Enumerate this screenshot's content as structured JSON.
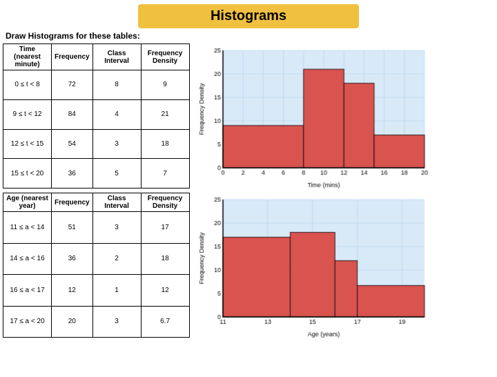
{
  "title": "Histograms",
  "subtitle": "Draw Histograms for these tables:",
  "table1": {
    "headers": [
      "Time (nearest minute)",
      "Frequency",
      "Class Interval",
      "Frequency Density"
    ],
    "rows": [
      [
        "0 ≤ t < 8",
        "72",
        "8",
        "9"
      ],
      [
        "9 ≤ t < 12",
        "84",
        "4",
        "21"
      ],
      [
        "12 ≤ t < 15",
        "54",
        "3",
        "18"
      ],
      [
        "15 ≤ t < 20",
        "36",
        "5",
        "7"
      ]
    ]
  },
  "table2": {
    "headers": [
      "Age (nearest year)",
      "Frequency",
      "Class Interval",
      "Frequency Density"
    ],
    "rows": [
      [
        "11 ≤ a < 14",
        "51",
        "3",
        "17"
      ],
      [
        "14 ≤ a < 16",
        "36",
        "2",
        "18"
      ],
      [
        "16 ≤ a < 17",
        "12",
        "1",
        "12"
      ],
      [
        "17 ≤ a < 20",
        "20",
        "3",
        "6.7"
      ]
    ]
  },
  "chart1": {
    "xLabel": "Time (mins)",
    "yLabel": "Frequency Density",
    "xMin": 0,
    "xMax": 20,
    "yMin": 0,
    "yMax": 25,
    "bars": [
      {
        "x": 0,
        "width": 8,
        "height": 9
      },
      {
        "x": 8,
        "width": 4,
        "height": 21
      },
      {
        "x": 12,
        "width": 3,
        "height": 18
      },
      {
        "x": 15,
        "width": 5,
        "height": 7
      }
    ]
  },
  "chart2": {
    "xLabel": "Age (years)",
    "yLabel": "Frequency Density",
    "xMin": 11,
    "xMax": 20,
    "yMin": 0,
    "yMax": 25,
    "bars": [
      {
        "x": 11,
        "width": 3,
        "height": 17
      },
      {
        "x": 14,
        "width": 2,
        "height": 18
      },
      {
        "x": 16,
        "width": 1,
        "height": 12
      },
      {
        "x": 17,
        "width": 3,
        "height": 6.7
      }
    ]
  }
}
